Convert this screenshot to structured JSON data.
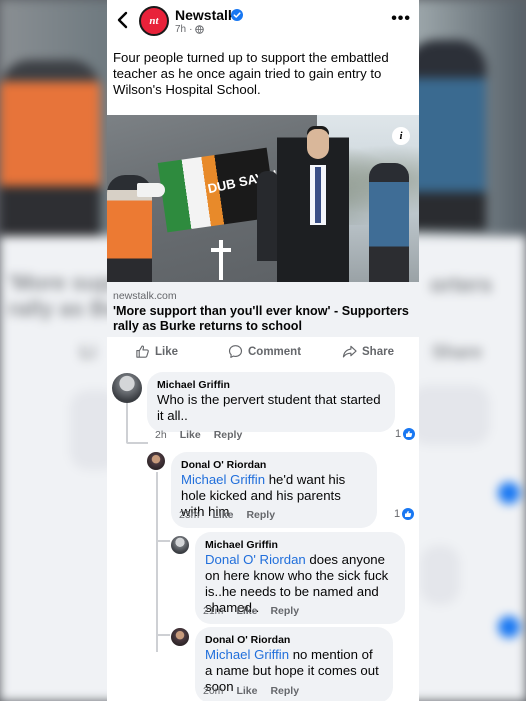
{
  "background": {
    "headline_fragment": "'More supp",
    "subline_fragment": "rally as Bu",
    "right_fragment": "orters",
    "action_like": "Li",
    "action_share": "Share"
  },
  "post": {
    "page_name": "Newstalk",
    "page_initials": "nt",
    "time": "7h",
    "text": "Four people turned up to support the embattled teacher as he once again tried to gain entry to Wilson's Hospital School.",
    "image_banner_text": "DUB SAVING",
    "link_domain": "newstalk.com",
    "link_title": "'More support than you'll ever know' - Supporters rally as Burke returns to school"
  },
  "actions": {
    "like": "Like",
    "comment": "Comment",
    "share": "Share"
  },
  "comments": [
    {
      "author": "Michael Griffin",
      "mention": "",
      "text": "Who is the pervert student that started it all..",
      "time": "2h",
      "like": "Like",
      "reply": "Reply",
      "reactions": "1"
    },
    {
      "author": "Donal O' Riordan",
      "mention": "Michael Griffin",
      "text": "he'd want his hole kicked and his parents with him",
      "time": "23m",
      "like": "Like",
      "reply": "Reply",
      "reactions": "1"
    },
    {
      "author": "Michael Griffin",
      "mention": "Donal O' Riordan",
      "text": "does anyone on here know who the sick fuck is..he needs to be named and shamed..",
      "time": "21m",
      "like": "Like",
      "reply": "Reply",
      "reactions": ""
    },
    {
      "author": "Donal O' Riordan",
      "mention": "Michael Griffin",
      "text": "no mention of a name but hope it comes out soon",
      "time": "20m",
      "like": "Like",
      "reply": "Reply",
      "reactions": ""
    }
  ],
  "colors": {
    "brand_red": "#e8223a",
    "mention_blue": "#216fdb",
    "reaction_blue": "#1877f2",
    "bubble_grey": "#f0f2f5"
  }
}
